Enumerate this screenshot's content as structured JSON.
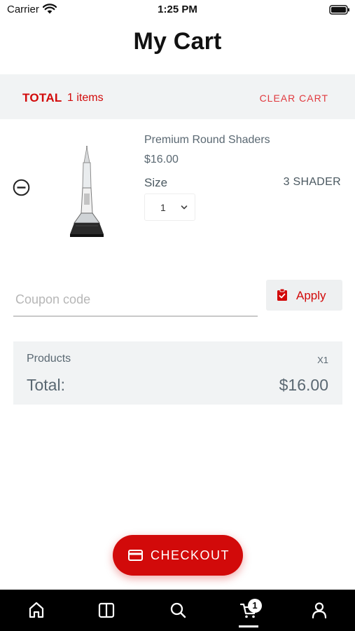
{
  "status_bar": {
    "carrier": "Carrier",
    "time": "1:25 PM"
  },
  "page": {
    "title": "My Cart"
  },
  "total_bar": {
    "total_label": "TOTAL",
    "items_count": "1 items",
    "clear_cart_label": "CLEAR CART"
  },
  "cart_items": [
    {
      "name": "Premium Round Shaders",
      "price": "$16.00",
      "size_label": "Size",
      "size_value": "3 SHADER",
      "quantity": "1"
    }
  ],
  "coupon": {
    "placeholder": "Coupon code",
    "value": "",
    "apply_label": "Apply"
  },
  "summary": {
    "products_label": "Products",
    "products_count": "X1",
    "total_label": "Total:",
    "total_value": "$16.00"
  },
  "checkout": {
    "label": "CHECKOUT"
  },
  "tab_bar": {
    "tabs": [
      {
        "icon": "home-icon"
      },
      {
        "icon": "catalog-icon"
      },
      {
        "icon": "search-icon"
      },
      {
        "icon": "cart-icon",
        "badge": "1",
        "active": true
      },
      {
        "icon": "account-icon"
      }
    ]
  },
  "colors": {
    "accent": "#d20a0a",
    "panel": "#f1f3f4",
    "tab_bar": "#000000",
    "muted_text": "#5a6872"
  }
}
